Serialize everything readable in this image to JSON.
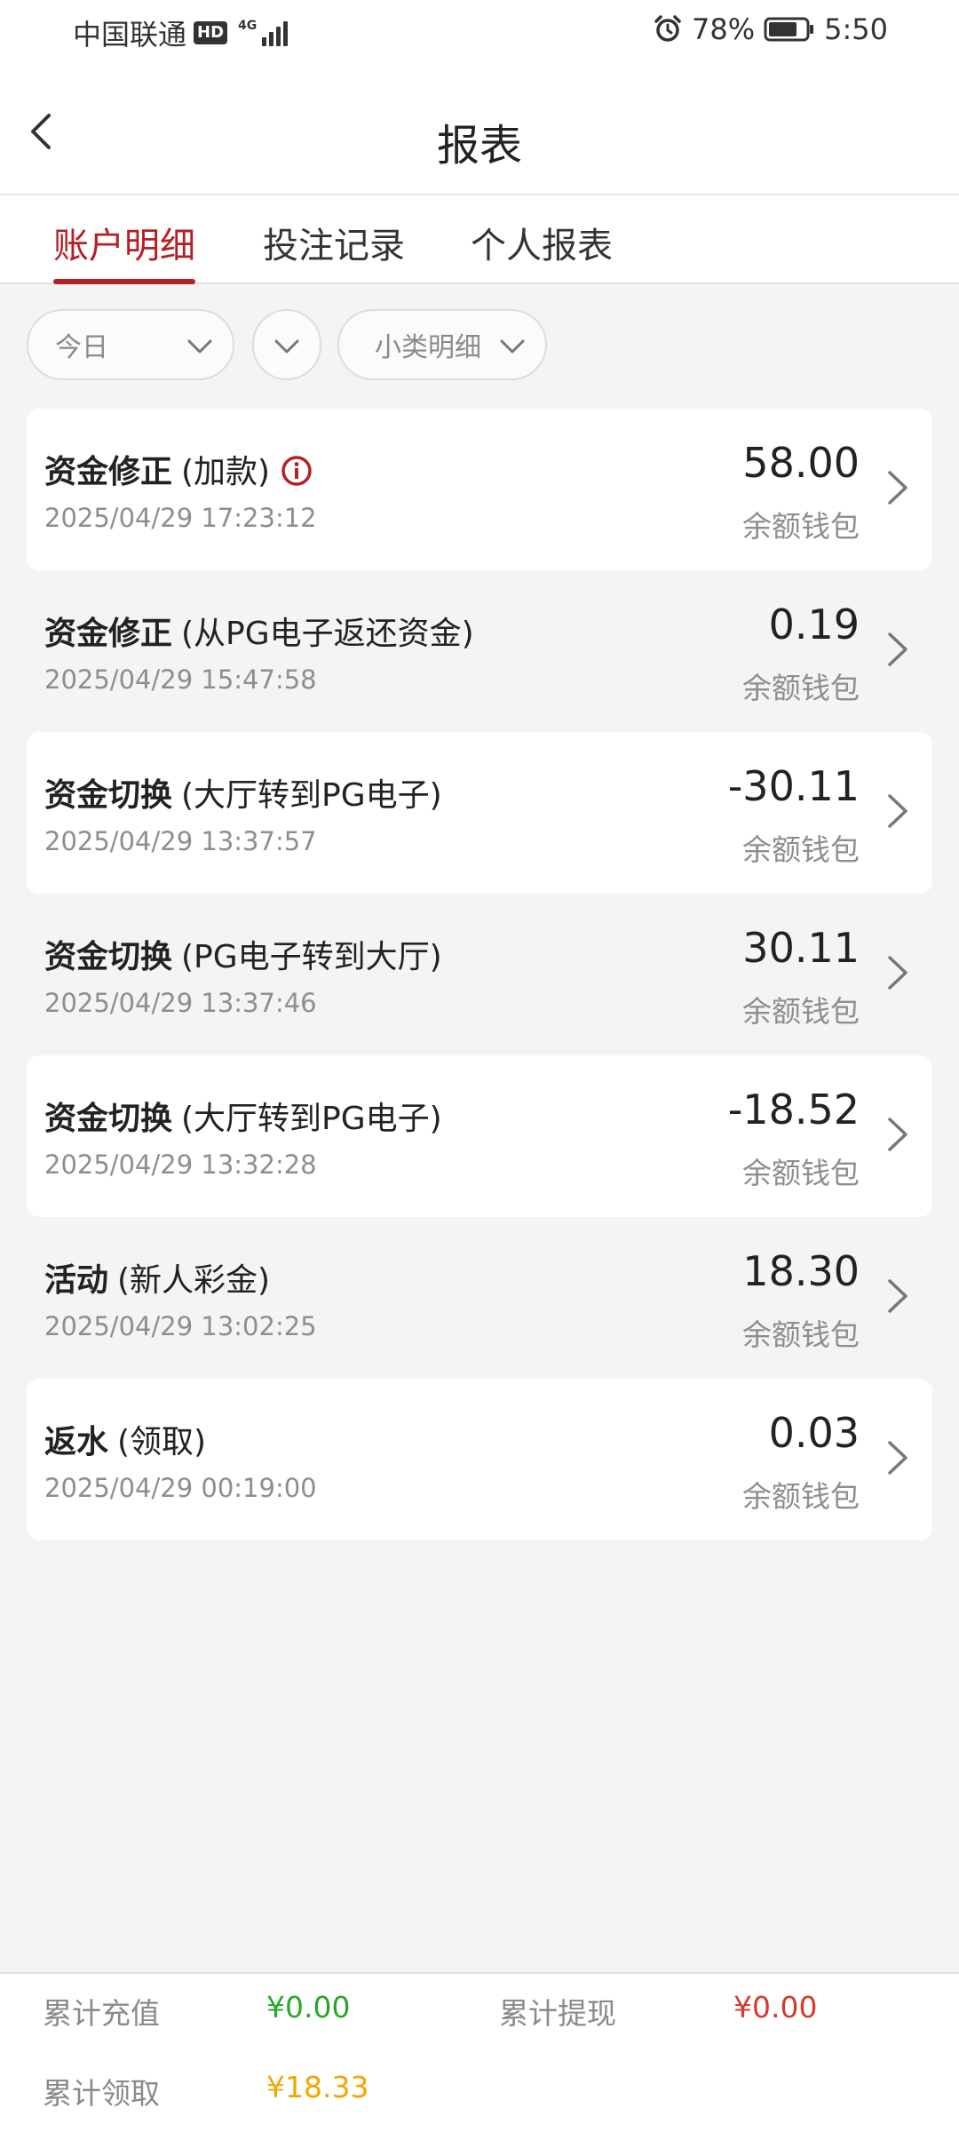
{
  "status_bar": {
    "carrier": "中国联通",
    "hd_badge": "HD",
    "network": "4G",
    "battery": "78%",
    "time": "5:50"
  },
  "header": {
    "title": "报表",
    "back_icon": "chevron-left-icon"
  },
  "tabs": [
    {
      "label": "账户明细",
      "active": true
    },
    {
      "label": "投注记录",
      "active": false
    },
    {
      "label": "个人报表",
      "active": false
    }
  ],
  "filters": {
    "date": "今日",
    "type": "",
    "subtype": "小类明细"
  },
  "records": [
    {
      "type": "资金修正",
      "detail": "(加款)",
      "time": "2025/04/29 17:23:12",
      "amount": "58.00",
      "wallet": "余额钱包",
      "info_icon": true
    },
    {
      "type": "资金修正",
      "detail": "(从PG电子返还资金)",
      "time": "2025/04/29 15:47:58",
      "amount": "0.19",
      "wallet": "余额钱包",
      "info_icon": false
    },
    {
      "type": "资金切换",
      "detail": "(大厅转到PG电子)",
      "time": "2025/04/29 13:37:57",
      "amount": "-30.11",
      "wallet": "余额钱包",
      "info_icon": false
    },
    {
      "type": "资金切换",
      "detail": "(PG电子转到大厅)",
      "time": "2025/04/29 13:37:46",
      "amount": "30.11",
      "wallet": "余额钱包",
      "info_icon": false
    },
    {
      "type": "资金切换",
      "detail": "(大厅转到PG电子)",
      "time": "2025/04/29 13:32:28",
      "amount": "-18.52",
      "wallet": "余额钱包",
      "info_icon": false
    },
    {
      "type": "活动",
      "detail": "(新人彩金)",
      "time": "2025/04/29 13:02:25",
      "amount": "18.30",
      "wallet": "余额钱包",
      "info_icon": false
    },
    {
      "type": "返水",
      "detail": "(领取)",
      "time": "2025/04/29 00:19:00",
      "amount": "0.03",
      "wallet": "余额钱包",
      "info_icon": false
    }
  ],
  "summary": {
    "recharge_label": "累计充值",
    "recharge_value": "¥0.00",
    "withdraw_label": "累计提现",
    "withdraw_value": "¥0.00",
    "claim_label": "累计领取",
    "claim_value": "¥18.33"
  },
  "colors": {
    "accent": "#b52025",
    "recharge": "#2aa62a",
    "withdraw": "#d43a2f",
    "claim": "#f0a800"
  }
}
